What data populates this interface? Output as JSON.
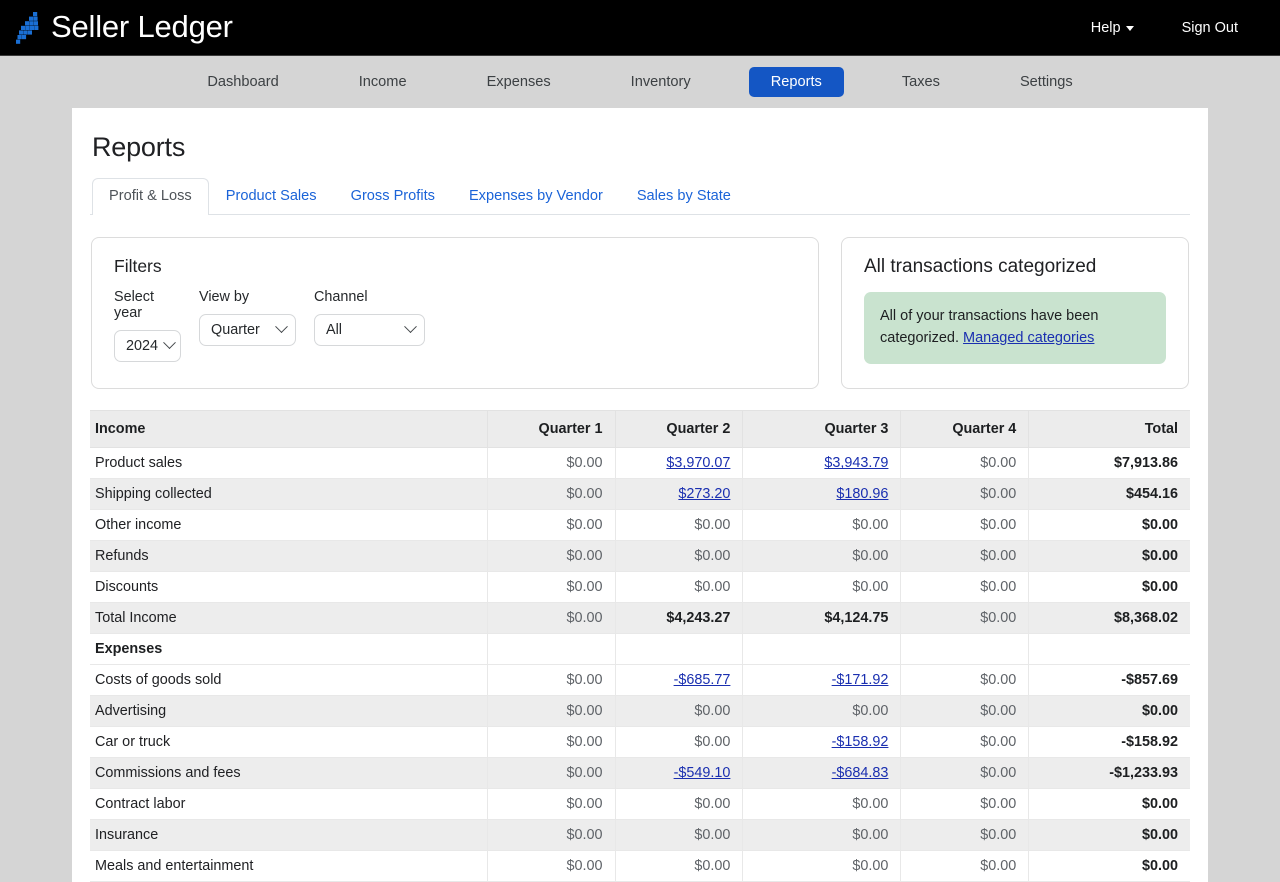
{
  "header": {
    "brand": "Seller Ledger",
    "logo_color": "#1a6fd4",
    "help_label": "Help",
    "signout_label": "Sign Out"
  },
  "nav": {
    "items": [
      {
        "label": "Dashboard",
        "active": false
      },
      {
        "label": "Income",
        "active": false
      },
      {
        "label": "Expenses",
        "active": false
      },
      {
        "label": "Inventory",
        "active": false
      },
      {
        "label": "Reports",
        "active": true
      },
      {
        "label": "Taxes",
        "active": false
      },
      {
        "label": "Settings",
        "active": false
      }
    ],
    "active_color": "#1456c4"
  },
  "page": {
    "title": "Reports"
  },
  "tabs": [
    {
      "label": "Profit & Loss",
      "active": true
    },
    {
      "label": "Product Sales",
      "active": false
    },
    {
      "label": "Gross Profits",
      "active": false
    },
    {
      "label": "Expenses by Vendor",
      "active": false
    },
    {
      "label": "Sales by State",
      "active": false
    }
  ],
  "filters": {
    "title": "Filters",
    "year": {
      "label": "Select year",
      "value": "2024"
    },
    "view_by": {
      "label": "View by",
      "value": "Quarter"
    },
    "channel": {
      "label": "Channel",
      "value": "All"
    }
  },
  "alert": {
    "title": "All transactions categorized",
    "text": "All of your transactions have been categorized. ",
    "link": "Managed categories",
    "bg_color": "#c9e3cf",
    "link_color": "#1a2fb0"
  },
  "table": {
    "headers": [
      "Income",
      "Quarter 1",
      "Quarter 2",
      "Quarter 3",
      "Quarter 4",
      "Total"
    ],
    "rows": [
      {
        "label": "Product sales",
        "type": "data",
        "cells": [
          {
            "text": "$0.00",
            "link": false,
            "zero": true
          },
          {
            "text": "$3,970.07",
            "link": true,
            "zero": false
          },
          {
            "text": "$3,943.79",
            "link": true,
            "zero": false
          },
          {
            "text": "$0.00",
            "link": false,
            "zero": true
          },
          {
            "text": "$7,913.86",
            "link": false,
            "zero": false
          }
        ]
      },
      {
        "label": "Shipping collected",
        "type": "data",
        "cells": [
          {
            "text": "$0.00",
            "link": false,
            "zero": true
          },
          {
            "text": "$273.20",
            "link": true,
            "zero": false
          },
          {
            "text": "$180.96",
            "link": true,
            "zero": false
          },
          {
            "text": "$0.00",
            "link": false,
            "zero": true
          },
          {
            "text": "$454.16",
            "link": false,
            "zero": false
          }
        ]
      },
      {
        "label": "Other income",
        "type": "data",
        "cells": [
          {
            "text": "$0.00",
            "link": false,
            "zero": true
          },
          {
            "text": "$0.00",
            "link": false,
            "zero": true
          },
          {
            "text": "$0.00",
            "link": false,
            "zero": true
          },
          {
            "text": "$0.00",
            "link": false,
            "zero": true
          },
          {
            "text": "$0.00",
            "link": false,
            "zero": false
          }
        ]
      },
      {
        "label": "Refunds",
        "type": "data",
        "cells": [
          {
            "text": "$0.00",
            "link": false,
            "zero": true
          },
          {
            "text": "$0.00",
            "link": false,
            "zero": true
          },
          {
            "text": "$0.00",
            "link": false,
            "zero": true
          },
          {
            "text": "$0.00",
            "link": false,
            "zero": true
          },
          {
            "text": "$0.00",
            "link": false,
            "zero": false
          }
        ]
      },
      {
        "label": "Discounts",
        "type": "data",
        "cells": [
          {
            "text": "$0.00",
            "link": false,
            "zero": true
          },
          {
            "text": "$0.00",
            "link": false,
            "zero": true
          },
          {
            "text": "$0.00",
            "link": false,
            "zero": true
          },
          {
            "text": "$0.00",
            "link": false,
            "zero": true
          },
          {
            "text": "$0.00",
            "link": false,
            "zero": false
          }
        ]
      },
      {
        "label": "Total Income",
        "type": "total",
        "cells": [
          {
            "text": "$0.00",
            "link": false,
            "zero": true
          },
          {
            "text": "$4,243.27",
            "link": false,
            "zero": false
          },
          {
            "text": "$4,124.75",
            "link": false,
            "zero": false
          },
          {
            "text": "$0.00",
            "link": false,
            "zero": true
          },
          {
            "text": "$8,368.02",
            "link": false,
            "zero": false
          }
        ]
      },
      {
        "label": "Expenses",
        "type": "section",
        "cells": []
      },
      {
        "label": "Costs of goods sold",
        "type": "data",
        "cells": [
          {
            "text": "$0.00",
            "link": false,
            "zero": true
          },
          {
            "text": "-$685.77",
            "link": true,
            "zero": false
          },
          {
            "text": "-$171.92",
            "link": true,
            "zero": false
          },
          {
            "text": "$0.00",
            "link": false,
            "zero": true
          },
          {
            "text": "-$857.69",
            "link": false,
            "zero": false
          }
        ]
      },
      {
        "label": "Advertising",
        "type": "data",
        "cells": [
          {
            "text": "$0.00",
            "link": false,
            "zero": true
          },
          {
            "text": "$0.00",
            "link": false,
            "zero": true
          },
          {
            "text": "$0.00",
            "link": false,
            "zero": true
          },
          {
            "text": "$0.00",
            "link": false,
            "zero": true
          },
          {
            "text": "$0.00",
            "link": false,
            "zero": false
          }
        ]
      },
      {
        "label": "Car or truck",
        "type": "data",
        "cells": [
          {
            "text": "$0.00",
            "link": false,
            "zero": true
          },
          {
            "text": "$0.00",
            "link": false,
            "zero": true
          },
          {
            "text": "-$158.92",
            "link": true,
            "zero": false
          },
          {
            "text": "$0.00",
            "link": false,
            "zero": true
          },
          {
            "text": "-$158.92",
            "link": false,
            "zero": false
          }
        ]
      },
      {
        "label": "Commissions and fees",
        "type": "data",
        "cells": [
          {
            "text": "$0.00",
            "link": false,
            "zero": true
          },
          {
            "text": "-$549.10",
            "link": true,
            "zero": false
          },
          {
            "text": "-$684.83",
            "link": true,
            "zero": false
          },
          {
            "text": "$0.00",
            "link": false,
            "zero": true
          },
          {
            "text": "-$1,233.93",
            "link": false,
            "zero": false
          }
        ]
      },
      {
        "label": "Contract labor",
        "type": "data",
        "cells": [
          {
            "text": "$0.00",
            "link": false,
            "zero": true
          },
          {
            "text": "$0.00",
            "link": false,
            "zero": true
          },
          {
            "text": "$0.00",
            "link": false,
            "zero": true
          },
          {
            "text": "$0.00",
            "link": false,
            "zero": true
          },
          {
            "text": "$0.00",
            "link": false,
            "zero": false
          }
        ]
      },
      {
        "label": "Insurance",
        "type": "data",
        "cells": [
          {
            "text": "$0.00",
            "link": false,
            "zero": true
          },
          {
            "text": "$0.00",
            "link": false,
            "zero": true
          },
          {
            "text": "$0.00",
            "link": false,
            "zero": true
          },
          {
            "text": "$0.00",
            "link": false,
            "zero": true
          },
          {
            "text": "$0.00",
            "link": false,
            "zero": false
          }
        ]
      },
      {
        "label": "Meals and entertainment",
        "type": "data",
        "cells": [
          {
            "text": "$0.00",
            "link": false,
            "zero": true
          },
          {
            "text": "$0.00",
            "link": false,
            "zero": true
          },
          {
            "text": "$0.00",
            "link": false,
            "zero": true
          },
          {
            "text": "$0.00",
            "link": false,
            "zero": true
          },
          {
            "text": "$0.00",
            "link": false,
            "zero": false
          }
        ]
      }
    ]
  }
}
